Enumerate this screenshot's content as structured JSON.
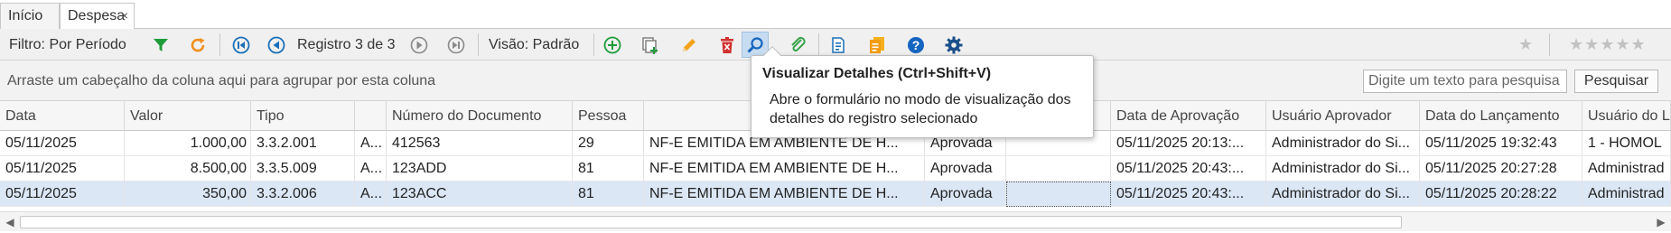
{
  "tabs": [
    {
      "label": "Início"
    },
    {
      "label": "Despesa",
      "close": "×"
    }
  ],
  "toolbar": {
    "filter_label": "Filtro: Por Período",
    "record_label": "Registro 3 de 3",
    "view_label": "Visão: Padrão",
    "favorite_star": "★",
    "rating_stars": "★★★★★"
  },
  "group_panel": {
    "hint": "Arraste um cabeçalho da coluna aqui para agrupar por esta coluna",
    "search_placeholder": "Digite um texto para pesquisa",
    "search_button": "Pesquisar"
  },
  "columns": [
    "Data",
    "Valor",
    "Tipo",
    "",
    "Número do Documento",
    "Pessoa",
    "",
    "",
    "",
    "Data de Aprovação",
    "Usuário Aprovador",
    "Data do Lançamento",
    "Usuário do L"
  ],
  "rows": [
    {
      "data": "05/11/2025",
      "valor": "1.000,00",
      "tipo": "3.3.2.001",
      "a": "A...",
      "numero": "412563",
      "pessoa": "29",
      "desc": "NF-E EMITIDA EM AMBIENTE DE H...",
      "status": "Aprovada",
      "blank": "",
      "data_aprov": "05/11/2025 20:13:...",
      "usuario_aprov": "Administrador do Si...",
      "data_lanc": "05/11/2025 19:32:43",
      "usuario_lanc": "1 - HOMOL"
    },
    {
      "data": "05/11/2025",
      "valor": "8.500,00",
      "tipo": "3.3.5.009",
      "a": "A...",
      "numero": "123ADD",
      "pessoa": "81",
      "desc": "NF-E EMITIDA EM AMBIENTE DE H...",
      "status": "Aprovada",
      "blank": "",
      "data_aprov": "05/11/2025 20:43:...",
      "usuario_aprov": "Administrador do Si...",
      "data_lanc": "05/11/2025 20:27:28",
      "usuario_lanc": "Administrad"
    },
    {
      "data": "05/11/2025",
      "valor": "350,00",
      "tipo": "3.3.2.006",
      "a": "A...",
      "numero": "123ACC",
      "pessoa": "81",
      "desc": "NF-E EMITIDA EM AMBIENTE DE H...",
      "status": "Aprovada",
      "blank": "",
      "data_aprov": "05/11/2025 20:43:...",
      "usuario_aprov": "Administrador do Si...",
      "data_lanc": "05/11/2025 20:28:22",
      "usuario_lanc": "Administrad"
    }
  ],
  "tooltip": {
    "title": "Visualizar Detalhes (Ctrl+Shift+V)",
    "body": "Abre o formulário no modo de visualização dos detalhes do registro selecionado"
  },
  "colors": {
    "selected_row": "#dbe7f5",
    "active_button": "#c7dcf1",
    "filter_green": "#1e9c3a",
    "refresh_orange": "#f0901e",
    "nav_blue": "#1a6fb8",
    "delete_red": "#d32f2f",
    "help_blue": "#1565c0"
  },
  "icons": [
    "filter-icon",
    "refresh-icon",
    "first-record-icon",
    "previous-record-icon",
    "next-record-icon",
    "last-record-icon",
    "add-icon",
    "duplicate-icon",
    "edit-icon",
    "delete-icon",
    "view-details-icon",
    "attachment-icon",
    "report-icon",
    "document-icon",
    "help-icon",
    "settings-icon",
    "star-icon"
  ]
}
